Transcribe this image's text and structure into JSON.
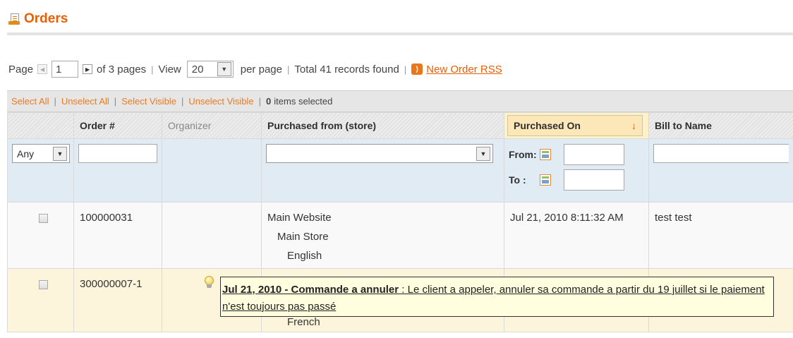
{
  "page": {
    "title": "Orders"
  },
  "pager": {
    "page_label": "Page",
    "page_value": "1",
    "of_pages": "of 3 pages",
    "view_label": "View",
    "view_value": "20",
    "per_page": "per page",
    "total": "Total 41 records found",
    "rss_link": "New Order RSS"
  },
  "massaction": {
    "select_all": "Select All",
    "unselect_all": "Unselect All",
    "select_visible": "Select Visible",
    "unselect_visible": "Unselect Visible",
    "selected_count": "0",
    "selected_text": "items selected"
  },
  "columns": {
    "order": "Order #",
    "organizer": "Organizer",
    "store": "Purchased from (store)",
    "purchased_on": "Purchased On",
    "bill_to": "Bill to Name"
  },
  "filters": {
    "any_value": "Any",
    "from_label": "From:",
    "to_label": "To :"
  },
  "rows": [
    {
      "order": "100000031",
      "store_website": "Main Website",
      "store_name": "Main Store",
      "store_view": "English",
      "purchased_on": "Jul 21, 2010 8:11:32 AM",
      "bill_to": "test test"
    },
    {
      "order": "300000007-1",
      "store_view": "French"
    }
  ],
  "tooltip": {
    "date": "Jul 21, 2010 - Commande a annuler",
    "text": " : Le client a appeler, annuler sa commande a partir du 19 juillet si le paiement n'est toujours pas passé"
  },
  "icons": {
    "title": "orders-icon",
    "rss": "rss-icon",
    "calendar": "calendar-icon",
    "note": "lightbulb-icon"
  },
  "colors": {
    "accent": "#eb5e00",
    "filter_row": "#e1ebf3",
    "highlight_row": "#fdf4dc"
  }
}
